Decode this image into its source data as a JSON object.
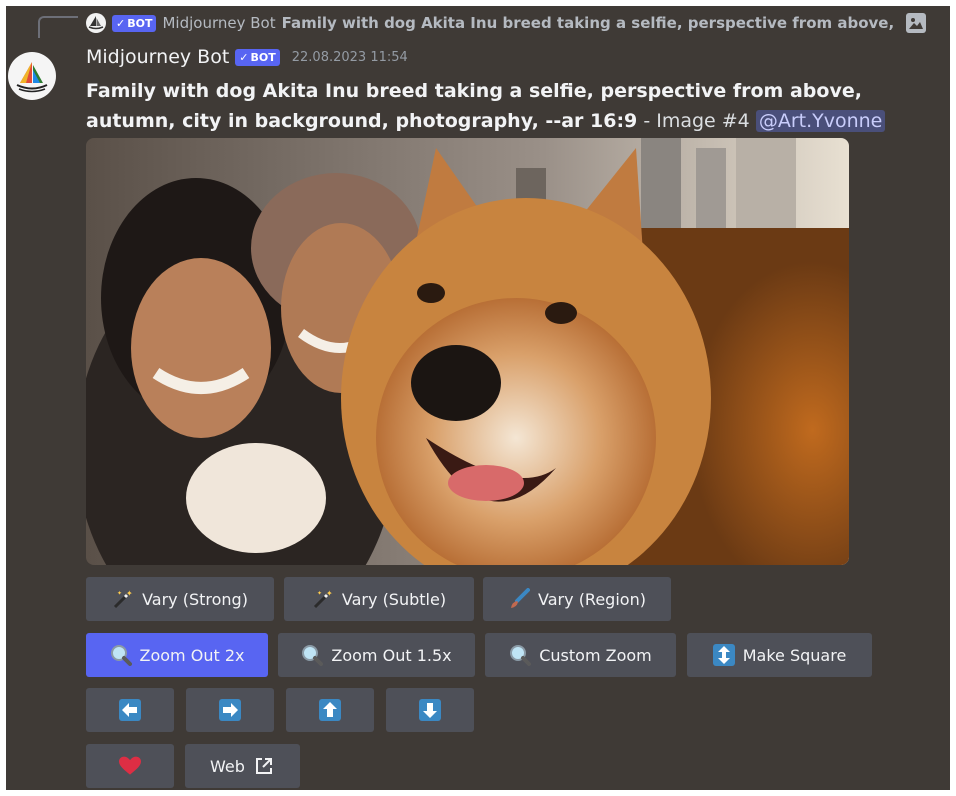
{
  "reply": {
    "author": "Midjourney Bot",
    "bot_tag": "BOT",
    "preview": "Family with dog Akita Inu breed taking a selfie, perspective from above,"
  },
  "message": {
    "author": "Midjourney Bot",
    "bot_tag": "BOT",
    "timestamp": "22.08.2023 11:54",
    "prompt": "Family with dog Akita Inu breed taking a selfie, perspective from above, autumn, city in background, photography, --ar 16:9",
    "separator": " - ",
    "image_label": "Image #4",
    "mention": "@Art.Yvonne"
  },
  "buttons": {
    "vary_strong": "Vary (Strong)",
    "vary_subtle": "Vary (Subtle)",
    "vary_region": "Vary (Region)",
    "zoom_out_2x": "Zoom Out 2x",
    "zoom_out_1_5x": "Zoom Out 1.5x",
    "custom_zoom": "Custom Zoom",
    "make_square": "Make Square",
    "web": "Web"
  },
  "colors": {
    "background": "#3f3a36",
    "button": "#4e5058",
    "primary_button": "#5865f2",
    "bot_tag": "#5865f2"
  }
}
